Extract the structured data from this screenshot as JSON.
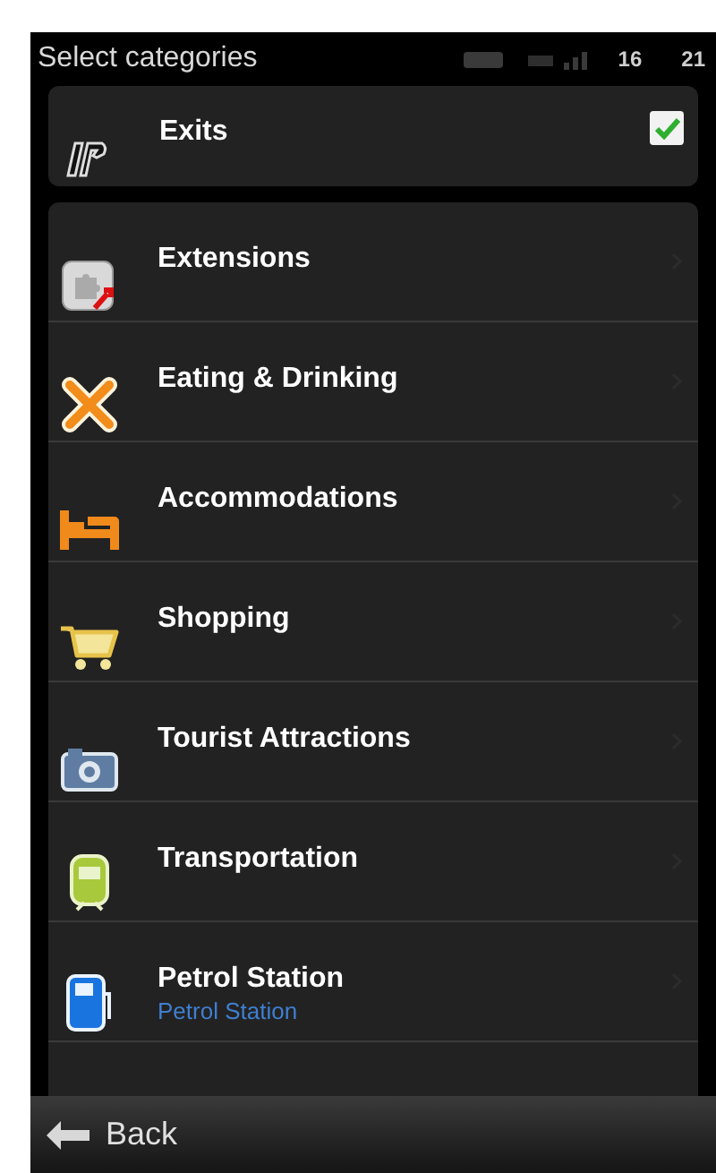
{
  "status_bar": {
    "title": "Select categories",
    "values": [
      "16",
      "21"
    ]
  },
  "pinned": {
    "label": "Exits",
    "checked": true
  },
  "categories": [
    {
      "label": "Extensions"
    },
    {
      "label": "Eating & Drinking"
    },
    {
      "label": "Accommodations"
    },
    {
      "label": "Shopping"
    },
    {
      "label": "Tourist Attractions"
    },
    {
      "label": "Transportation"
    },
    {
      "label": "Petrol Station",
      "sublabel": "Petrol Station"
    }
  ],
  "bottom_bar": {
    "back_label": "Back"
  }
}
